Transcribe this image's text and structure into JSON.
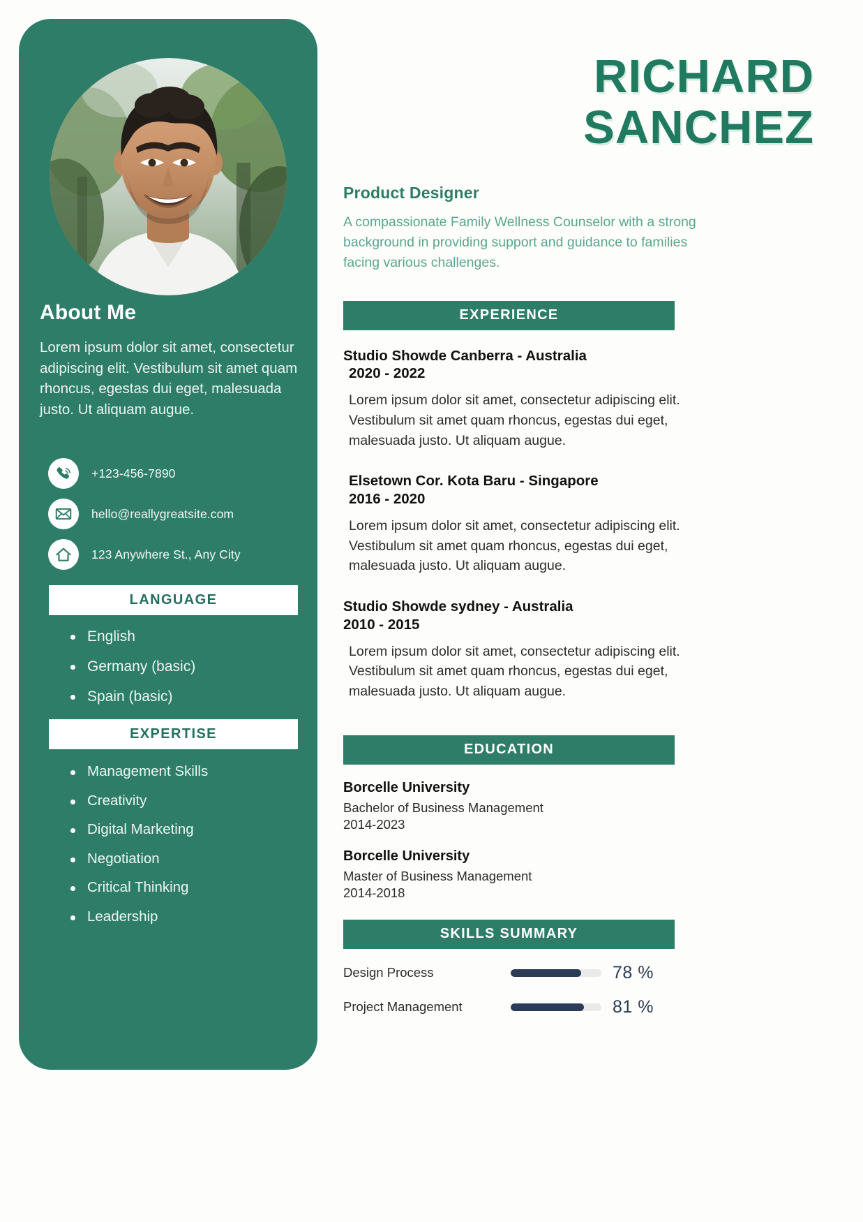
{
  "theme": {
    "sidebar_green": "#2e7d69",
    "name_green": "#1f7a60",
    "summary_green": "#5aa68e",
    "skill_navy": "#2c3b55",
    "page_bg": "#fdfdfb"
  },
  "sidebar": {
    "about_title": "About Me",
    "about_text": "Lorem ipsum dolor sit amet, consectetur adipiscing elit. Vestibulum sit amet quam rhoncus, egestas dui eget, malesuada justo. Ut aliquam augue.",
    "contacts": [
      {
        "icon": "phone-icon",
        "value": "+123-456-7890"
      },
      {
        "icon": "email-icon",
        "value": "hello@reallygreatsite.com"
      },
      {
        "icon": "home-icon",
        "value": "123 Anywhere St., Any City"
      }
    ],
    "language_heading": "LANGUAGE",
    "languages": [
      "English",
      "Germany (basic)",
      "Spain (basic)"
    ],
    "expertise_heading": "EXPERTISE",
    "expertise": [
      "Management Skills",
      "Creativity",
      "Digital Marketing",
      "Negotiation",
      "Critical Thinking",
      "Leadership"
    ]
  },
  "header": {
    "first_name": "RICHARD",
    "last_name": "SANCHEZ",
    "role": "Product Designer",
    "summary": "A compassionate Family Wellness Counselor with a strong background in providing support and guidance to families facing various challenges."
  },
  "experience": {
    "heading": "EXPERIENCE",
    "jobs": [
      {
        "title": "Studio Showde Canberra - Australia",
        "dates": "2020 - 2022",
        "description": "Lorem ipsum dolor sit amet, consectetur adipiscing elit. Vestibulum sit amet quam rhoncus, egestas dui eget, malesuada justo. Ut aliquam augue."
      },
      {
        "title": "Elsetown Cor. Kota Baru - Singapore",
        "dates": "2016 - 2020",
        "description": "Lorem ipsum dolor sit amet, consectetur adipiscing elit. Vestibulum sit amet quam rhoncus, egestas dui eget, malesuada justo. Ut aliquam augue."
      },
      {
        "title": "Studio Showde sydney - Australia",
        "dates": "2010 - 2015",
        "description": "Lorem ipsum dolor sit amet, consectetur adipiscing elit. Vestibulum sit amet quam rhoncus, egestas dui eget, malesuada justo. Ut aliquam augue."
      }
    ]
  },
  "education": {
    "heading": "EDUCATION",
    "entries": [
      {
        "school": "Borcelle University",
        "degree": "Bachelor of Business Management",
        "years": "2014-2023"
      },
      {
        "school": "Borcelle University",
        "degree": "Master of Business Management",
        "years": "2014-2018"
      }
    ]
  },
  "skills": {
    "heading": "SKILLS SUMMARY",
    "items": [
      {
        "name": "Design Process",
        "percent": 78,
        "percent_label": "78 %"
      },
      {
        "name": "Project Management",
        "percent": 81,
        "percent_label": "81 %"
      }
    ]
  }
}
